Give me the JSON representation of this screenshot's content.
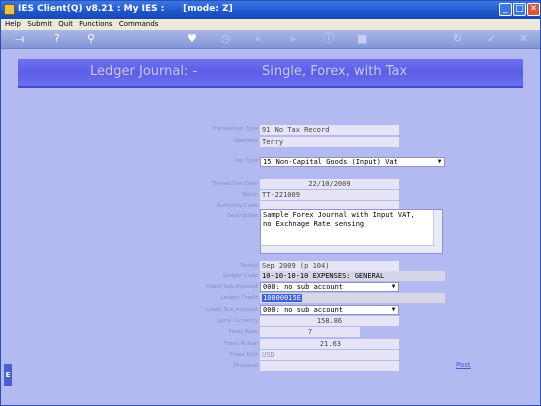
{
  "window": {
    "title": "IES Client(Q) v8.21 : My IES :      [mode: Z]"
  },
  "menu": [
    "Help",
    "Submit",
    "Quit",
    "Functions",
    "Commands"
  ],
  "toolbar": {
    "icons": [
      "power-icon",
      "help-icon",
      "search-icon",
      "heart-icon",
      "clock-icon",
      "rewind-icon",
      "fast-forward-icon",
      "info-icon",
      "stop-icon",
      "refresh-icon",
      "check-icon",
      "close-icon"
    ],
    "glyphs": [
      "⟞",
      "?",
      "⚲",
      "♥",
      "◷",
      "«",
      "»",
      "ⓘ",
      "■",
      "↻",
      "✓",
      "✕"
    ]
  },
  "banner": {
    "left": "Ledger Journal: -",
    "right": "Single, Forex, with Tax"
  },
  "form": {
    "transaction_type": {
      "label": "Transaction Type",
      "value": "91 No Tax Record"
    },
    "operator": {
      "label": "Operator",
      "value": "Terry"
    },
    "vat_type": {
      "label": "Vat Type",
      "value": "15 Non-Capital Goods (Input) Vat"
    },
    "transaction_date": {
      "label": "Transaction Date",
      "value": "22/10/2009"
    },
    "batch": {
      "label": "Batch",
      "value": "TT-221009"
    },
    "authority_code": {
      "label": "Authority Code",
      "value": ""
    },
    "description": {
      "label": "Description",
      "lines": [
        "Sample Forex Journal with Input VAT,",
        "no Exchnage Rate sensing"
      ]
    },
    "period": {
      "label": "Period",
      "value": "Sep 2009 (p 104)"
    },
    "ledger_code": {
      "label": "Ledger Code",
      "value": "10-10-10-10 EXPENSES: GENERAL"
    },
    "debit_sub_account": {
      "label": "Debit Sub Account",
      "value": "000: no sub account"
    },
    "ledger_credit": {
      "label": "Ledger Credit",
      "value": "10000015E"
    },
    "credit_sub_account": {
      "label": "Credit Sub Account",
      "value": "000: no sub account"
    },
    "local_currency": {
      "label": "Local Currency",
      "value": "158.86"
    },
    "forex_rate": {
      "label": "Forex Rate",
      "value": "7"
    },
    "forex_actual": {
      "label": "Forex Actual",
      "value": "21.63"
    },
    "forex_unit": {
      "label": "Forex Unit",
      "value": "USD"
    },
    "dividend": {
      "label": "Dividend",
      "value": ""
    }
  },
  "actions": {
    "post": "Post"
  },
  "side_tab": "E"
}
